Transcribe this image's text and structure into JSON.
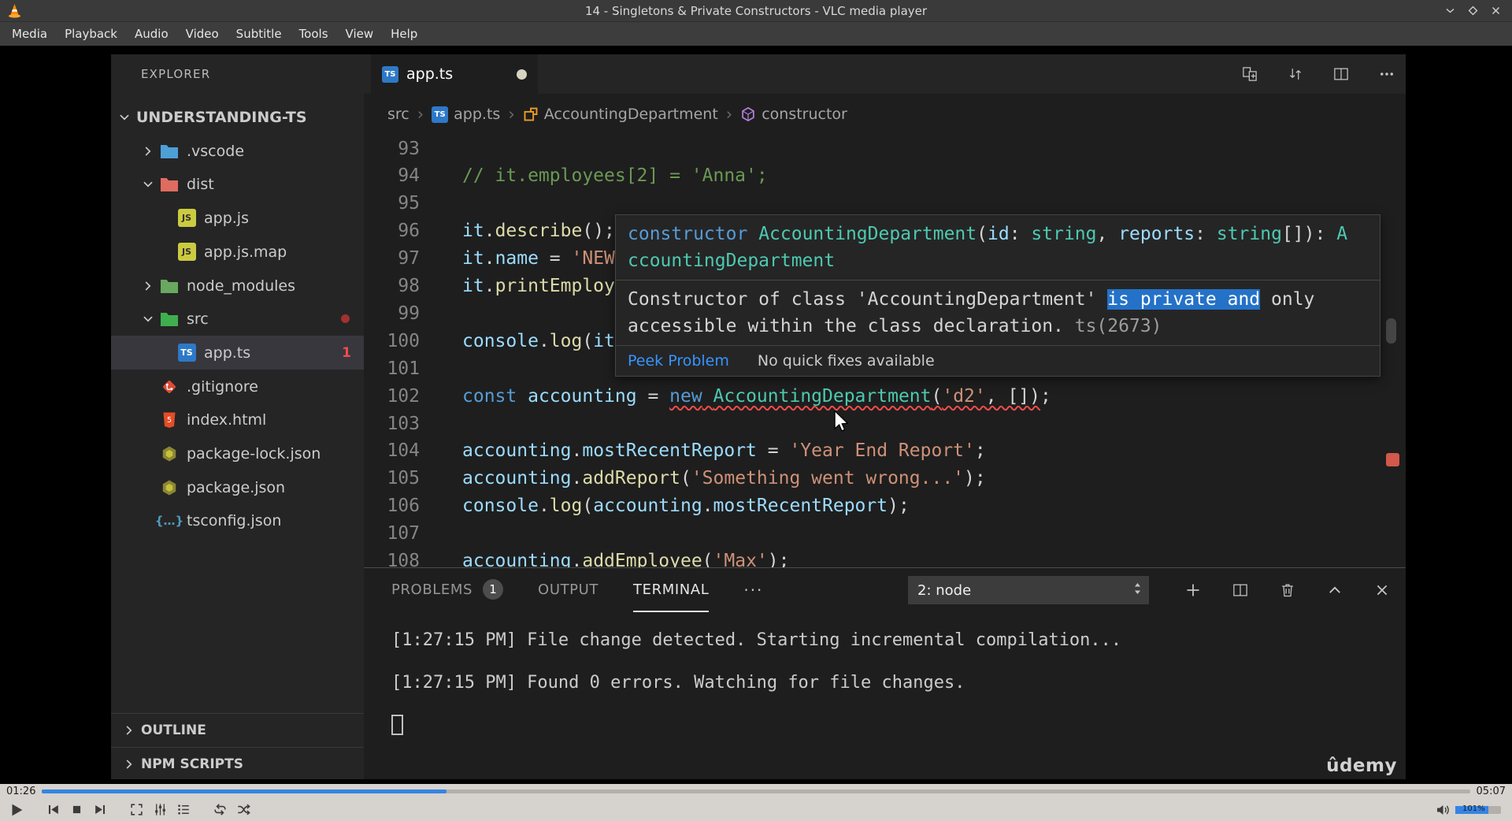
{
  "colors": {
    "accent-blue": "#3584e4",
    "editor-bg": "#1e1e1e",
    "sidebar-bg": "#252526",
    "selection-blue": "#2472c8",
    "error-red": "#f14c4c",
    "link-blue": "#3794ff",
    "syn-keyword": "#569cd6",
    "syn-type": "#4ec9b0",
    "syn-string": "#ce9178",
    "syn-comment": "#6a9955",
    "syn-variable": "#9cdcfe",
    "syn-function": "#dcdcaa",
    "syn-plain": "#d4d4d4"
  },
  "vlc": {
    "window_title": "14 - Singletons & Private Constructors - VLC media player",
    "menu": [
      "Media",
      "Playback",
      "Audio",
      "Video",
      "Subtitle",
      "Tools",
      "View",
      "Help"
    ],
    "window_controls": [
      "minimize",
      "maximize",
      "close"
    ],
    "controls": [
      "play",
      "previous",
      "stop",
      "next",
      "fullscreen",
      "extended-settings",
      "playlist",
      "loop",
      "random"
    ],
    "elapsed": "01:26",
    "duration": "05:07",
    "progress_pct": 28.3,
    "volume_label": "101%"
  },
  "watermark": "ûdemy",
  "vscode": {
    "explorer": {
      "title": "EXPLORER",
      "root_label": "UNDERSTANDING-TS",
      "tree": [
        {
          "label": ".vscode",
          "icon": "vscode-folder",
          "level": 1,
          "chevron": "right"
        },
        {
          "label": "dist",
          "icon": "folder-dist",
          "level": 1,
          "chevron": "down"
        },
        {
          "label": "app.js",
          "icon": "js",
          "level": 2
        },
        {
          "label": "app.js.map",
          "icon": "js",
          "level": 2
        },
        {
          "label": "node_modules",
          "icon": "folder-node-modules",
          "level": 1,
          "chevron": "right"
        },
        {
          "label": "src",
          "icon": "folder-src",
          "level": 1,
          "chevron": "down",
          "dot": true
        },
        {
          "label": "app.ts",
          "icon": "ts",
          "level": 2,
          "selected": true,
          "badge": "1"
        },
        {
          "label": ".gitignore",
          "icon": "git",
          "level": 1
        },
        {
          "label": "index.html",
          "icon": "html",
          "level": 1
        },
        {
          "label": "package-lock.json",
          "icon": "npm",
          "level": 1
        },
        {
          "label": "package.json",
          "icon": "npm",
          "level": 1
        },
        {
          "label": "tsconfig.json",
          "icon": "tsconfig",
          "level": 1
        }
      ],
      "sections": [
        "OUTLINE",
        "NPM SCRIPTS"
      ]
    },
    "tab": {
      "label": "app.ts"
    },
    "editor_actions": [
      "open-changes",
      "compare-changes",
      "split-editor",
      "more-actions"
    ],
    "breadcrumb": [
      {
        "label": "src"
      },
      {
        "label": "app.ts",
        "icon": "ts"
      },
      {
        "label": "AccountingDepartment",
        "icon": "symbol-class"
      },
      {
        "label": "constructor",
        "icon": "symbol-method"
      }
    ],
    "editor": {
      "lines": [
        {
          "n": 93,
          "segs": []
        },
        {
          "n": 94,
          "segs": [
            [
              "c",
              "// it.employees[2] = 'Anna';"
            ]
          ]
        },
        {
          "n": 95,
          "segs": []
        },
        {
          "n": 96,
          "segs": [
            [
              "v",
              "it"
            ],
            [
              "p",
              "."
            ],
            [
              "f",
              "describe"
            ],
            [
              "p",
              "();"
            ]
          ]
        },
        {
          "n": 97,
          "segs": [
            [
              "v",
              "it"
            ],
            [
              "p",
              "."
            ],
            [
              "v",
              "name"
            ],
            [
              "p",
              " = "
            ],
            [
              "s",
              "'NEW"
            ]
          ]
        },
        {
          "n": 98,
          "segs": [
            [
              "v",
              "it"
            ],
            [
              "p",
              "."
            ],
            [
              "f",
              "printEmploy"
            ]
          ]
        },
        {
          "n": 99,
          "segs": []
        },
        {
          "n": 100,
          "segs": [
            [
              "v",
              "console"
            ],
            [
              "p",
              "."
            ],
            [
              "f",
              "log"
            ],
            [
              "p",
              "("
            ],
            [
              "v",
              "it"
            ]
          ]
        },
        {
          "n": 101,
          "segs": []
        },
        {
          "n": 102,
          "segs": [
            [
              "k",
              "const"
            ],
            [
              "p",
              " "
            ],
            [
              "v",
              "accounting"
            ],
            [
              "p",
              " = "
            ],
            [
              "k",
              "new",
              "u"
            ],
            [
              "p",
              " ",
              "u"
            ],
            [
              "t",
              "AccountingDepartment",
              "u"
            ],
            [
              "p",
              "(",
              "u"
            ],
            [
              "s",
              "'d2'",
              "u"
            ],
            [
              "p",
              ", [])",
              "u"
            ],
            [
              "p",
              ";"
            ]
          ]
        },
        {
          "n": 103,
          "segs": []
        },
        {
          "n": 104,
          "segs": [
            [
              "v",
              "accounting"
            ],
            [
              "p",
              "."
            ],
            [
              "v",
              "mostRecentReport"
            ],
            [
              "p",
              " = "
            ],
            [
              "s",
              "'Year End Report'"
            ],
            [
              "p",
              ";"
            ]
          ]
        },
        {
          "n": 105,
          "segs": [
            [
              "v",
              "accounting"
            ],
            [
              "p",
              "."
            ],
            [
              "f",
              "addReport"
            ],
            [
              "p",
              "("
            ],
            [
              "s",
              "'Something went wrong...'"
            ],
            [
              "p",
              ");"
            ]
          ]
        },
        {
          "n": 106,
          "segs": [
            [
              "v",
              "console"
            ],
            [
              "p",
              "."
            ],
            [
              "f",
              "log"
            ],
            [
              "p",
              "("
            ],
            [
              "v",
              "accounting"
            ],
            [
              "p",
              "."
            ],
            [
              "v",
              "mostRecentReport"
            ],
            [
              "p",
              ");"
            ]
          ]
        },
        {
          "n": 107,
          "segs": []
        },
        {
          "n": 108,
          "segs": [
            [
              "v",
              "accounting"
            ],
            [
              "p",
              "."
            ],
            [
              "f",
              "addEmployee"
            ],
            [
              "p",
              "("
            ],
            [
              "s",
              "'Max'"
            ],
            [
              "p",
              ");"
            ]
          ]
        }
      ]
    },
    "hover": {
      "signature_lines": [
        [
          [
            "k",
            "constructor"
          ],
          [
            "p",
            " "
          ],
          [
            "t",
            "AccountingDepartment"
          ],
          [
            "p",
            "("
          ],
          [
            "v",
            "id"
          ],
          [
            "p",
            ": "
          ],
          [
            "t",
            "string"
          ],
          [
            "p",
            ", "
          ],
          [
            "v",
            "reports"
          ],
          [
            "p",
            ": "
          ],
          [
            "t",
            "string"
          ],
          [
            "p",
            "[]): "
          ],
          [
            "t",
            "A"
          ]
        ],
        [
          [
            "t",
            "ccountingDepartment"
          ]
        ]
      ],
      "body_lines": [
        [
          [
            "p",
            "Constructor of class 'AccountingDepartment' "
          ],
          [
            "hl",
            "is private and"
          ],
          [
            "p",
            " only"
          ]
        ],
        [
          [
            "p",
            "accessible within the class declaration. "
          ],
          [
            "dim",
            "ts(2673)"
          ]
        ]
      ],
      "peek_label": "Peek Problem",
      "status_text": "No quick fixes available"
    },
    "panel": {
      "tabs": [
        {
          "label": "PROBLEMS",
          "badge": "1"
        },
        {
          "label": "OUTPUT"
        },
        {
          "label": "TERMINAL",
          "active": true
        }
      ],
      "overflow_label": "···",
      "dropdown_value": "2: node",
      "actions": [
        "new-terminal",
        "split-terminal",
        "kill-terminal",
        "maximize-panel",
        "close-panel"
      ],
      "terminal_lines": [
        "[1:27:15 PM] File change detected. Starting incremental compilation...",
        "",
        "[1:27:15 PM] Found 0 errors. Watching for file changes."
      ]
    }
  }
}
